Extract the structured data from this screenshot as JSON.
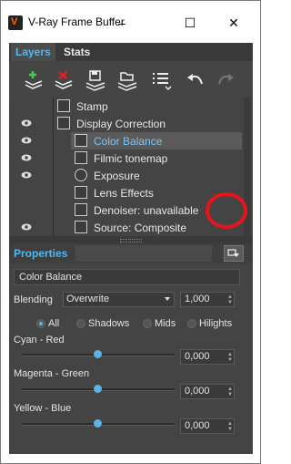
{
  "window": {
    "title": "V-Ray Frame Buffer",
    "minimize": "–",
    "maximize": "☐",
    "close": "✕"
  },
  "tabs": [
    {
      "label": "Layers",
      "active": true
    },
    {
      "label": "Stats",
      "active": false
    }
  ],
  "toolbar": {
    "buttons": [
      "add-layer-icon",
      "delete-layer-icon",
      "save-layers-icon",
      "load-layers-icon",
      "layer-menu-icon",
      "undo-icon",
      "redo-icon"
    ]
  },
  "layers": [
    {
      "label": "Stamp",
      "visible": false,
      "indent": 1,
      "icon": "stamp-icon"
    },
    {
      "label": "Display Correction",
      "visible": true,
      "indent": 1,
      "icon": "display-correction-icon"
    },
    {
      "label": "Color Balance",
      "visible": true,
      "indent": 2,
      "icon": "color-balance-icon",
      "selected": true
    },
    {
      "label": "Filmic tonemap",
      "visible": true,
      "indent": 2,
      "icon": "filmic-icon"
    },
    {
      "label": "Exposure",
      "visible": true,
      "indent": 2,
      "icon": "exposure-icon"
    },
    {
      "label": "Lens Effects",
      "visible": false,
      "indent": 2,
      "icon": "lens-effects-icon"
    },
    {
      "label": "Denoiser: unavailable",
      "visible": false,
      "indent": 2,
      "icon": "denoiser-icon"
    },
    {
      "label": "Source: Composite",
      "visible": true,
      "indent": 2,
      "icon": "source-icon"
    }
  ],
  "properties": {
    "title": "Properties",
    "layer_name": "Color Balance",
    "blending_label": "Blending",
    "blending_value": "Overwrite",
    "blending_amount": "1,000",
    "ranges": [
      {
        "label": "All",
        "selected": true
      },
      {
        "label": "Shadows",
        "selected": false
      },
      {
        "label": "Mids",
        "selected": false
      },
      {
        "label": "Hilights",
        "selected": false
      }
    ],
    "sliders": [
      {
        "label": "Cyan - Red",
        "value": "0,000",
        "position": 0.5
      },
      {
        "label": "Magenta - Green",
        "value": "0,000",
        "position": 0.5
      },
      {
        "label": "Yellow - Blue",
        "value": "0,000",
        "position": 0.5
      }
    ]
  },
  "colors": {
    "accent": "#4fb8f0",
    "panel": "#444444",
    "highlight_circle": "#e8141b"
  }
}
